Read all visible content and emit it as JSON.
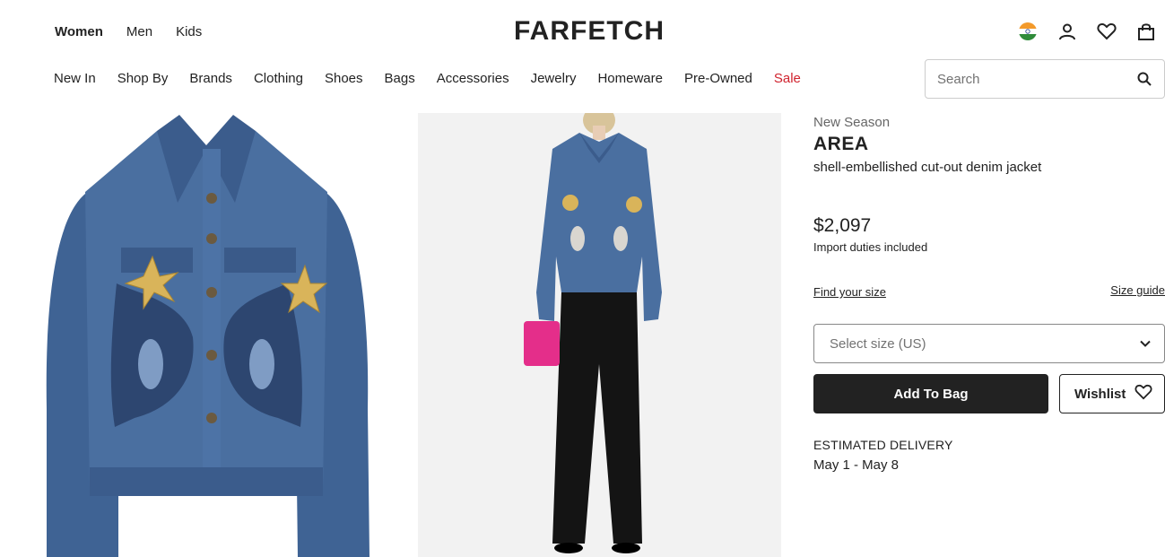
{
  "header": {
    "gender_nav": [
      "Women",
      "Men",
      "Kids"
    ],
    "active_gender": "Women",
    "logo": "FARFETCH",
    "icons": [
      "india-flag-icon",
      "account-icon",
      "wishlist-heart-icon",
      "shopping-bag-icon"
    ]
  },
  "category_nav": [
    {
      "label": "New In"
    },
    {
      "label": "Shop By"
    },
    {
      "label": "Brands"
    },
    {
      "label": "Clothing"
    },
    {
      "label": "Shoes"
    },
    {
      "label": "Bags"
    },
    {
      "label": "Accessories"
    },
    {
      "label": "Jewelry"
    },
    {
      "label": "Homeware"
    },
    {
      "label": "Pre-Owned"
    },
    {
      "label": "Sale"
    }
  ],
  "search": {
    "placeholder": "Search",
    "icon": "search-icon"
  },
  "gallery": {
    "images": [
      "denim-jacket-flatlay-image",
      "model-wearing-jacket-image"
    ]
  },
  "product": {
    "season": "New Season",
    "brand": "AREA",
    "name": "shell-embellished cut-out denim jacket",
    "price": "$2,097",
    "duties": "Import duties included",
    "find_size": "Find your size",
    "size_guide": "Size guide",
    "size_select_placeholder": "Select size (US)",
    "add_to_bag": "Add To Bag",
    "wishlist": "Wishlist",
    "delivery_heading": "ESTIMATED DELIVERY",
    "delivery_dates": "May 1 - May 8"
  },
  "colors": {
    "text": "#222222",
    "sale": "#d0232e",
    "button_bg": "#222222",
    "denim": "#3d5d8a"
  }
}
